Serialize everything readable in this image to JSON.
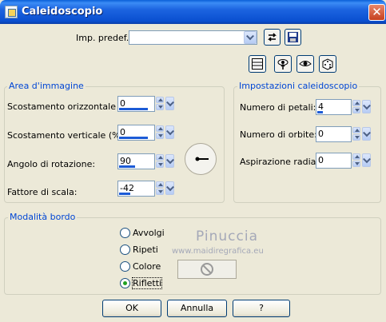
{
  "window": {
    "title": "Caleidoscopio",
    "close_glyph": "✕"
  },
  "preset": {
    "label": "Imp. predef.:",
    "value": ""
  },
  "icons": {
    "restore": "restore-defaults-icon",
    "save": "save-floppy-icon",
    "toolbar": [
      "dialog-layout-icon",
      "proof-hand-icon",
      "eye-preview-icon",
      "random-dice-icon"
    ]
  },
  "image_area": {
    "title": "Area d'immagine",
    "fields": [
      {
        "label": "Scostamento orizzontale (%):",
        "value": "0"
      },
      {
        "label": "Scostamento verticale (%):",
        "value": "0"
      },
      {
        "label": "Angolo di rotazione:",
        "value": "90"
      },
      {
        "label": "Fattore di scala:",
        "value": "-42"
      }
    ]
  },
  "kaleido": {
    "title": "Impostazioni caleidoscopio",
    "fields": [
      {
        "label": "Numero di petali:",
        "value": "4"
      },
      {
        "label": "Numero di orbite:",
        "value": "0"
      },
      {
        "label": "Aspirazione radiale:",
        "value": "0"
      }
    ]
  },
  "edge_mode": {
    "title": "Modalità bordo",
    "options": [
      {
        "label": "Avvolgi",
        "selected": false
      },
      {
        "label": "Ripeti",
        "selected": false
      },
      {
        "label": "Colore",
        "selected": false
      },
      {
        "label": "Rifletti",
        "selected": true
      }
    ]
  },
  "watermark": {
    "name": "Pinuccia",
    "url": "www.maidiregrafica.eu"
  },
  "buttons": {
    "ok": "OK",
    "cancel": "Annulla",
    "help": "?"
  },
  "colors": {
    "title_bar": "#0a4fd0",
    "group_title": "#0046d5",
    "close": "#c6401f",
    "background": "#ece9d8"
  }
}
